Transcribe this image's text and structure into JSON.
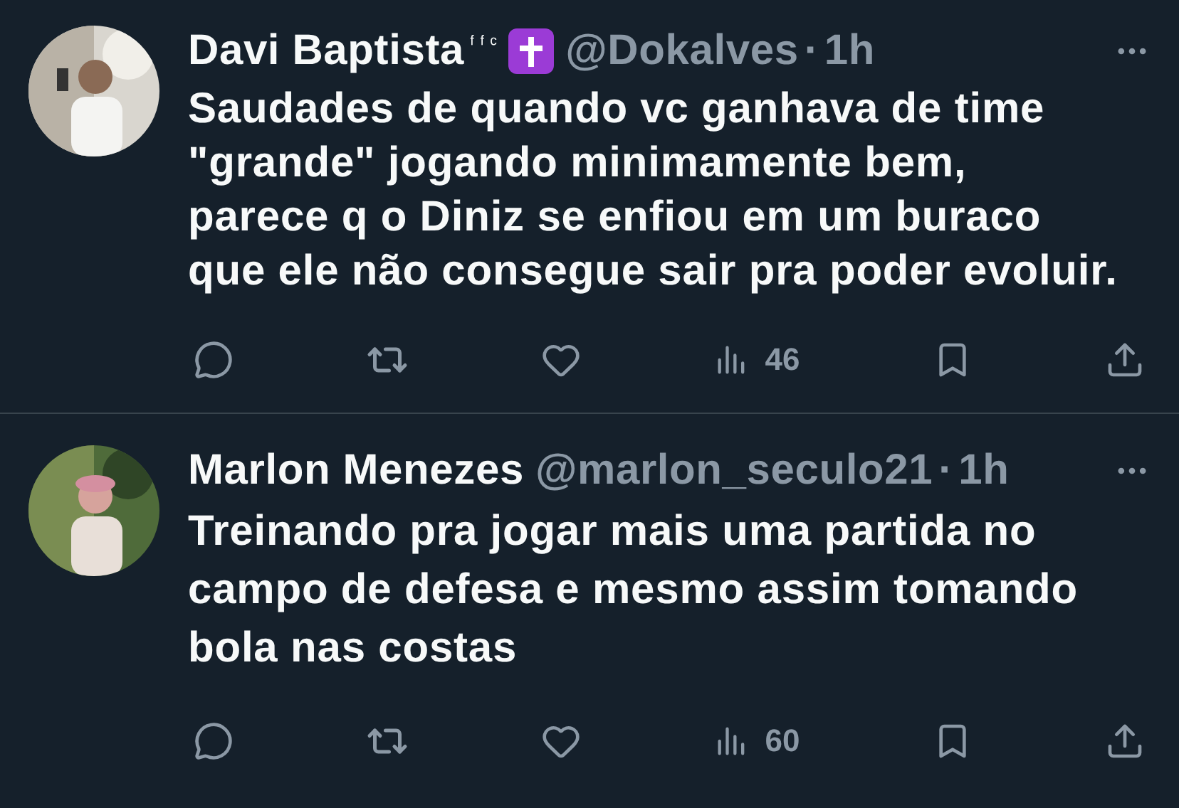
{
  "tweets": [
    {
      "name": "Davi Baptista",
      "name_suffix": "ᶠ ᶠ ᶜ",
      "badge": true,
      "handle": "@Dokalves",
      "separator": "·",
      "time": "1h",
      "body_lines": [
        "Saudades de quando vc ganhava de time",
        "\"grande\" jogando minimamente bem,",
        "parece q o Diniz se enfiou em um buraco",
        "que ele não consegue sair pra poder evoluir."
      ],
      "views": "46",
      "avatar": {
        "kind": "picture"
      }
    },
    {
      "name": "Marlon Menezes",
      "badge": false,
      "handle": "@marlon_seculo21",
      "separator": "·",
      "time": "1h",
      "body_lines": [
        "Treinando pra jogar mais uma partida no",
        "campo de defesa e mesmo assim tomando",
        "bola nas costas"
      ],
      "views": "60",
      "avatar": {
        "kind": "picture"
      }
    }
  ]
}
